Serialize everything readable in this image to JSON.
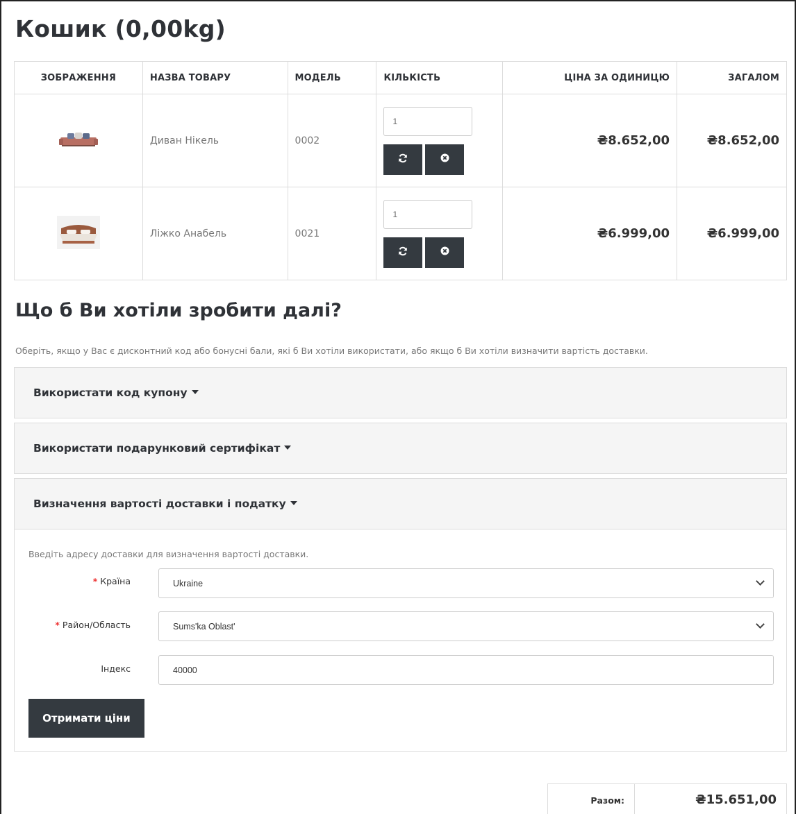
{
  "page": {
    "title": "Кошик  (0,00kg)"
  },
  "cart": {
    "headers": {
      "image": "ЗОБРАЖЕННЯ",
      "name": "НАЗВА ТОВАРУ",
      "model": "МОДЕЛЬ",
      "quantity": "КІЛЬКІСТЬ",
      "unit_price": "ЦІНА ЗА ОДИНИЦЮ",
      "total": "ЗАГАЛОМ"
    },
    "items": [
      {
        "name": "Диван Нікель",
        "model": "0002",
        "quantity": "1",
        "unit_price": "₴8.652,00",
        "total": "₴8.652,00",
        "image_icon": "sofa-image"
      },
      {
        "name": "Ліжко Анабель",
        "model": "0021",
        "quantity": "1",
        "unit_price": "₴6.999,00",
        "total": "₴6.999,00",
        "image_icon": "bed-image"
      }
    ],
    "update_icon": "refresh-icon",
    "remove_icon": "remove-circle-icon"
  },
  "next": {
    "heading": "Що б Ви хотіли зробити далі?",
    "intro": "Оберіть, якщо у Вас є дисконтний код або бонусні бали, які б Ви хотіли використати, або якщо б Ви хотіли визначити вартість доставки.",
    "panels": [
      {
        "title": "Використати код купону"
      },
      {
        "title": "Використати подарунковий сертифікат"
      },
      {
        "title": "Визначення вартості доставки і податку"
      }
    ]
  },
  "shipping": {
    "hint": "Введіть адресу доставки для визначення вартості доставки.",
    "required_mark": "*",
    "country_label": "Країна",
    "country_value": "Ukraine",
    "region_label": "Район/Область",
    "region_value": "Sums'ka Oblast'",
    "postcode_label": "Індекс",
    "postcode_value": "40000",
    "quote_button": "Отримати ціни"
  },
  "summary": {
    "label": "Разом:",
    "value": "₴15.651,00"
  },
  "colors": {
    "dark_button": "#343a40",
    "required": "#ee3333",
    "panel_bg": "#f5f5f5"
  }
}
